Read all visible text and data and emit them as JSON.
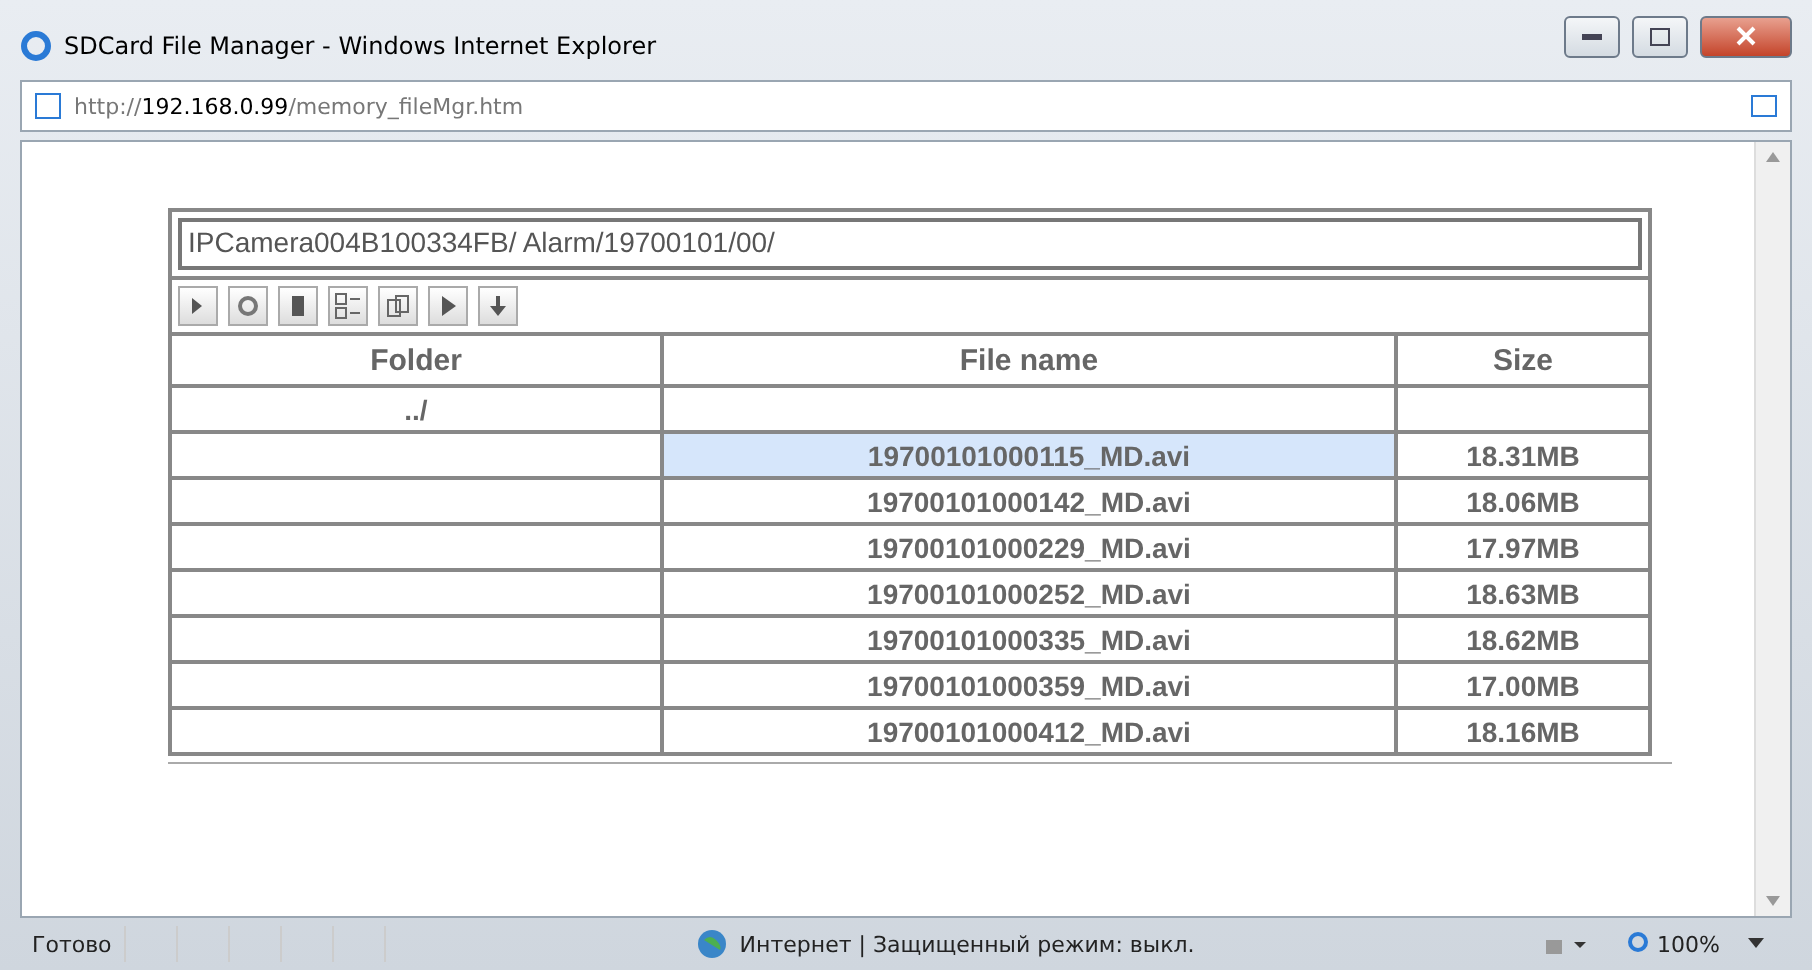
{
  "window": {
    "title": "SDCard File Manager - Windows Internet Explorer"
  },
  "address": {
    "scheme": "http://",
    "host": "192.168.0.99",
    "path": "/memory_fileMgr.htm"
  },
  "path_field": {
    "value": "IPCamera004B100334FB/ Alarm/19700101/00/"
  },
  "table": {
    "columns": [
      "Folder",
      "File name",
      "Size"
    ],
    "rows": [
      {
        "folder": "../",
        "file": "",
        "size": "",
        "selected": false
      },
      {
        "folder": "",
        "file": "19700101000115_MD.avi",
        "size": "18.31MB",
        "selected": true
      },
      {
        "folder": "",
        "file": "19700101000142_MD.avi",
        "size": "18.06MB",
        "selected": false
      },
      {
        "folder": "",
        "file": "19700101000229_MD.avi",
        "size": "17.97MB",
        "selected": false
      },
      {
        "folder": "",
        "file": "19700101000252_MD.avi",
        "size": "18.63MB",
        "selected": false
      },
      {
        "folder": "",
        "file": "19700101000335_MD.avi",
        "size": "18.62MB",
        "selected": false
      },
      {
        "folder": "",
        "file": "19700101000359_MD.avi",
        "size": "17.00MB",
        "selected": false
      },
      {
        "folder": "",
        "file": "19700101000412_MD.avi",
        "size": "18.16MB",
        "selected": false
      }
    ]
  },
  "status_bar": {
    "status": "Готово",
    "zone": "Интернет | Защищенный режим: выкл.",
    "zoom": "100%"
  }
}
